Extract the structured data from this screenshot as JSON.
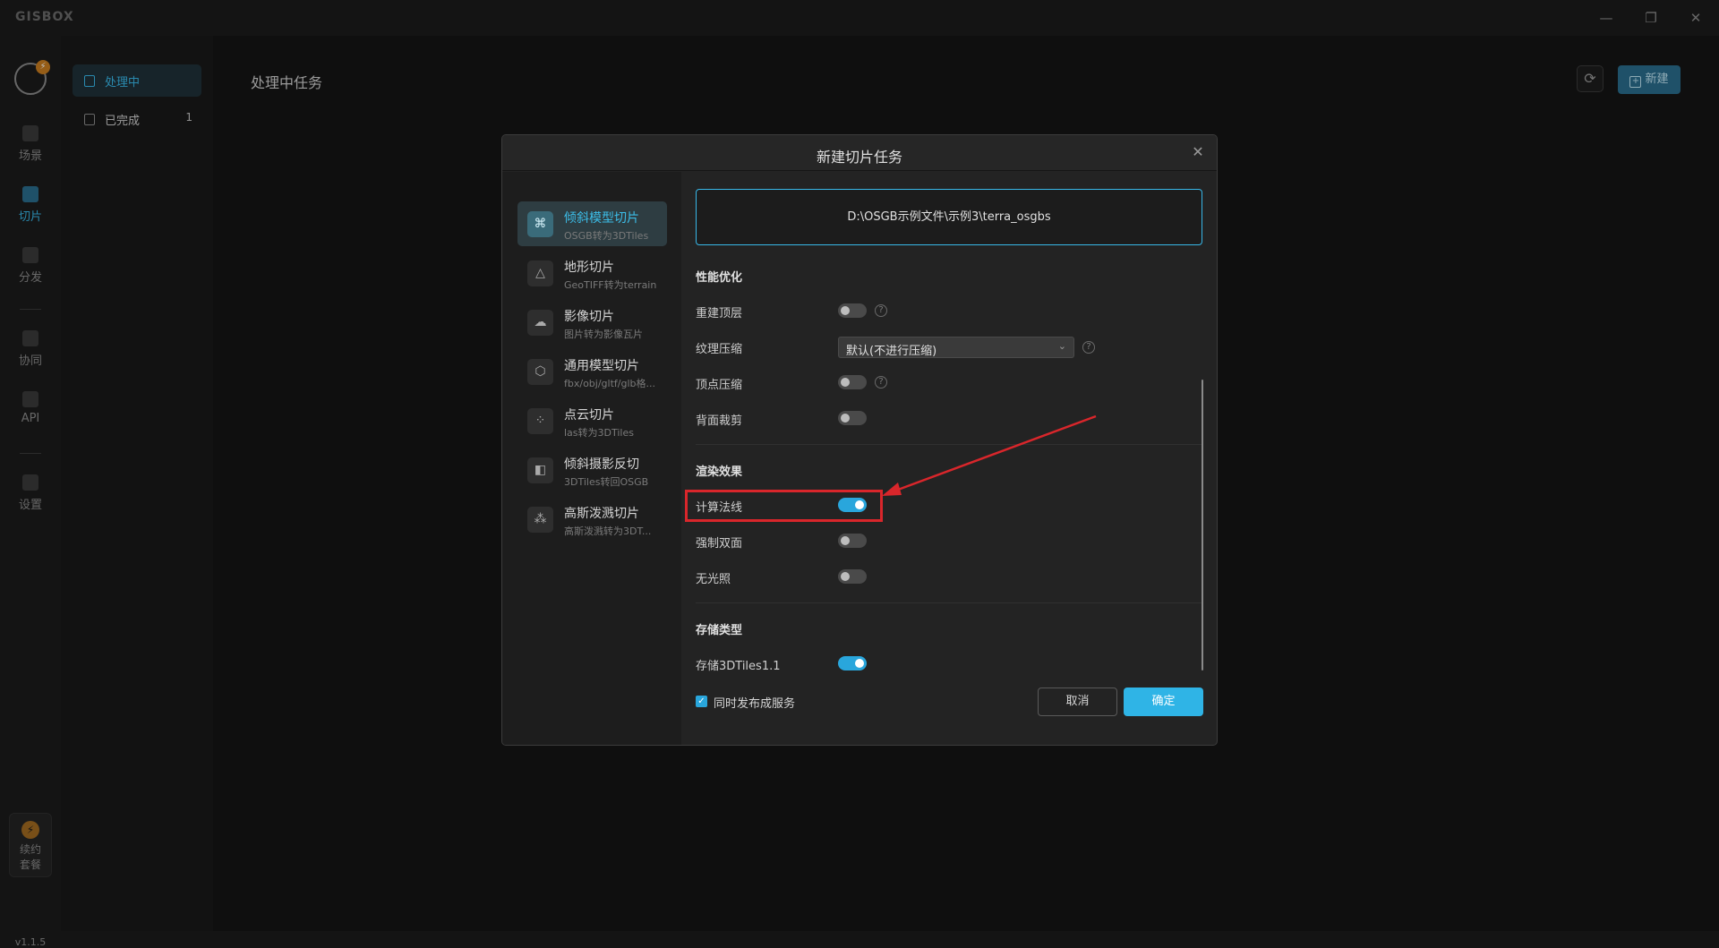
{
  "app": {
    "logo": "GISBOX",
    "minimize_glyph": "—",
    "restore_glyph": "❐",
    "close_glyph": "✕",
    "version": "v1.1.5"
  },
  "nav": {
    "avatar_badge": "⚡",
    "items": [
      {
        "label": "场景",
        "icon": "scene-icon"
      },
      {
        "label": "切片",
        "icon": "tiles-icon"
      },
      {
        "label": "分发",
        "icon": "distribute-icon"
      },
      {
        "label": "协同",
        "icon": "collab-icon"
      },
      {
        "label": "API",
        "icon": "api-icon"
      },
      {
        "label": "设置",
        "icon": "settings-icon"
      }
    ],
    "renew_icon": "⚡",
    "renew_label": "续约套餐"
  },
  "subnav": {
    "items": [
      {
        "label": "处理中",
        "count": ""
      },
      {
        "label": "已完成",
        "count": "1"
      }
    ]
  },
  "main": {
    "title": "处理中任务",
    "refresh_glyph": "⟳",
    "new_glyph": "+",
    "new_button": "新建"
  },
  "dialog": {
    "title": "新建切片任务",
    "close_glyph": "✕",
    "categories": [
      {
        "title": "倾斜模型切片",
        "subtitle": "OSGB转为3DTiles",
        "glyph": "⌘"
      },
      {
        "title": "地形切片",
        "subtitle": "GeoTIFF转为terrain",
        "glyph": "△"
      },
      {
        "title": "影像切片",
        "subtitle": "图片转为影像瓦片",
        "glyph": "☁"
      },
      {
        "title": "通用模型切片",
        "subtitle": "fbx/obj/gltf/glb格...",
        "glyph": "⬡"
      },
      {
        "title": "点云切片",
        "subtitle": "las转为3DTiles",
        "glyph": "⁘"
      },
      {
        "title": "倾斜摄影反切",
        "subtitle": "3DTiles转回OSGB",
        "glyph": "◧"
      },
      {
        "title": "高斯泼溅切片",
        "subtitle": "高斯泼溅转为3DT...",
        "glyph": "⁂"
      }
    ],
    "path": "D:\\OSGB示例文件\\示例3\\terra_osgbs",
    "sections": {
      "performance": "性能优化",
      "render": "渲染效果",
      "storage": "存储类型"
    },
    "options": {
      "rebuild_top": {
        "label": "重建顶层",
        "on": false
      },
      "texture_compress": {
        "label": "纹理压缩",
        "value": "默认(不进行压缩)"
      },
      "vertex_compress": {
        "label": "顶点压缩",
        "on": false
      },
      "backface_cull": {
        "label": "背面裁剪",
        "on": false
      },
      "compute_normals": {
        "label": "计算法线",
        "on": true
      },
      "force_double_side": {
        "label": "强制双面",
        "on": false
      },
      "no_lighting": {
        "label": "无光照",
        "on": false
      },
      "store_3dtiles11": {
        "label": "存储3DTiles1.1",
        "on": true
      }
    },
    "help_glyph": "?",
    "select_arrow": "⌄",
    "publish_checkbox": {
      "label": "同时发布成服务",
      "checked": true,
      "glyph": "✓"
    },
    "cancel_button": "取消",
    "ok_button": "确定"
  },
  "colors": {
    "accent": "#29a6dc",
    "highlight": "#d9262b",
    "background": "#141414"
  }
}
